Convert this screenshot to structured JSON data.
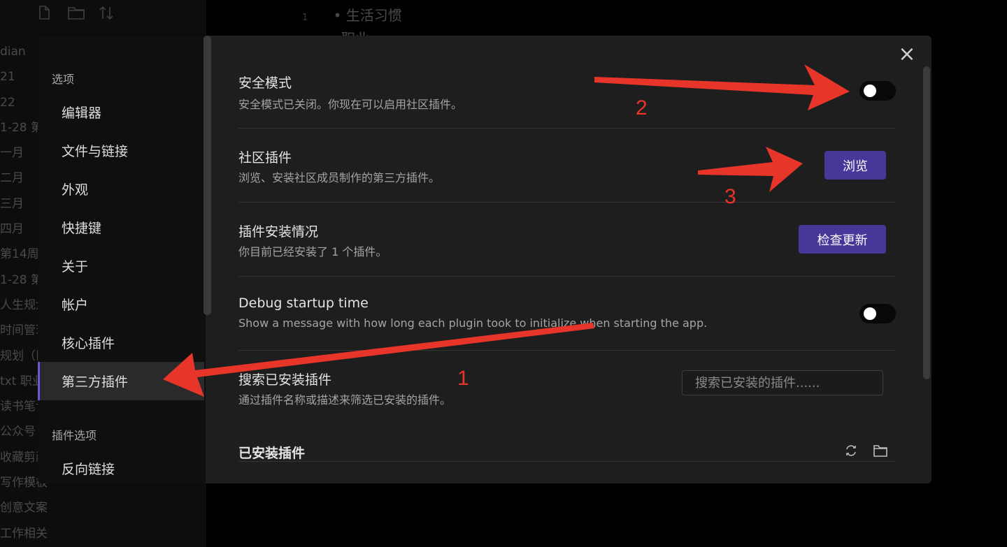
{
  "background": {
    "file_list": [
      "dian",
      "21",
      "22",
      "1-28 第",
      "一月",
      "二月",
      "三月",
      "四月",
      "第14周",
      "1-28 第",
      "人生规划",
      "时间管理",
      "规划（旧",
      "txt 职业",
      "读书笔记",
      "公众号",
      "收藏剪藏",
      "写作模板",
      "创意文案",
      "工作相关"
    ],
    "editor": {
      "line_number": "1",
      "line_text": "• 生活习惯",
      "next_line": "职业"
    }
  },
  "settings_sidebar": {
    "section_options": "选项",
    "options_items": [
      "编辑器",
      "文件与链接",
      "外观",
      "快捷键",
      "关于",
      "帐户",
      "核心插件",
      "第三方插件"
    ],
    "active_item": "第三方插件",
    "section_plugin_options": "插件选项",
    "plugin_option_items": [
      "反向链接"
    ]
  },
  "content": {
    "close_icon": "close-icon",
    "safe_mode": {
      "name": "安全模式",
      "desc": "安全模式已关闭。你现在可以启用社区插件。",
      "toggle_on": false
    },
    "community_plugins": {
      "name": "社区插件",
      "desc": "浏览、安装社区成员制作的第三方插件。",
      "button": "浏览"
    },
    "plugin_status": {
      "name": "插件安装情况",
      "desc": "你目前已经安装了 1 个插件。",
      "button": "检查更新"
    },
    "debug_startup": {
      "name": "Debug startup time",
      "desc": "Show a message with how long each plugin took to initialize when starting the app.",
      "toggle_on": false
    },
    "search_installed": {
      "name": "搜索已安装插件",
      "desc": "通过插件名称或描述来筛选已安装的插件。",
      "placeholder": "搜索已安装的插件......"
    },
    "installed_heading": "已安装插件",
    "installed_icons": [
      "reload-icon",
      "folder-icon"
    ]
  },
  "annotations": {
    "color": "#e8352a",
    "labels": [
      "1",
      "2",
      "3"
    ]
  }
}
